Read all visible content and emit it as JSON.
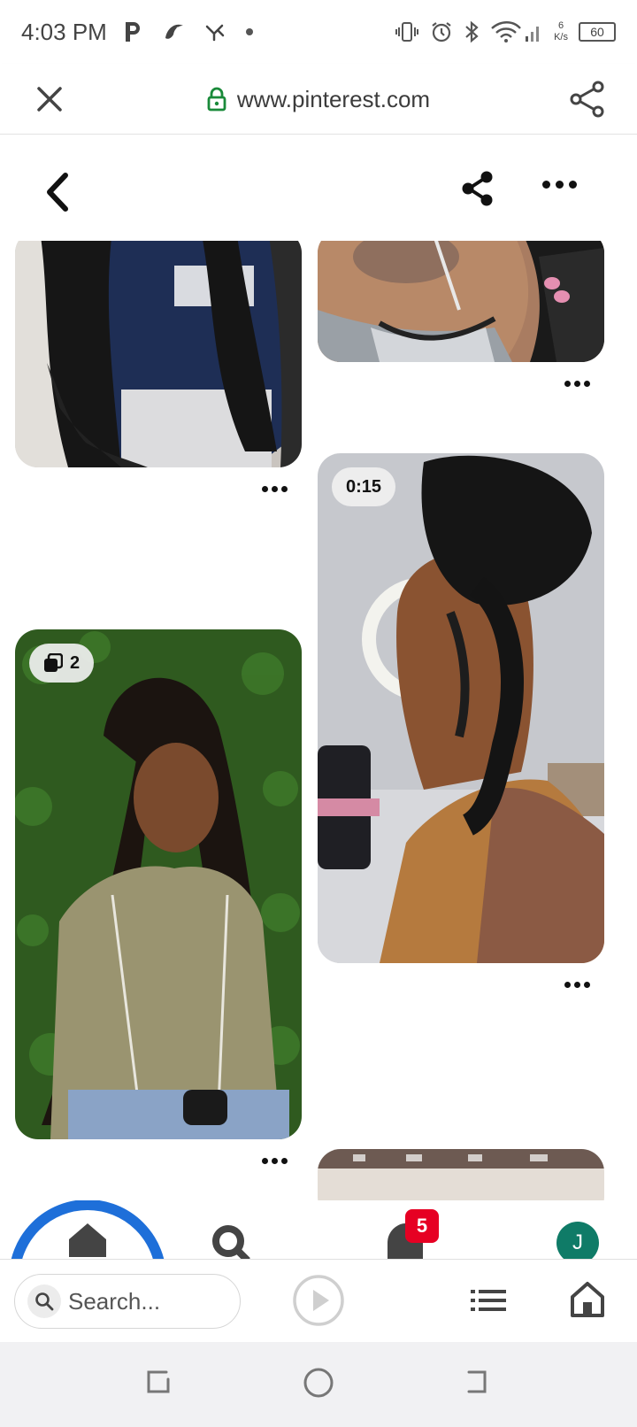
{
  "status_bar": {
    "time": "4:03 PM",
    "net_speed_value": "6",
    "net_speed_unit": "K/s",
    "battery": "60"
  },
  "browser": {
    "url": "www.pinterest.com"
  },
  "pins": [
    {
      "badge": ""
    },
    {
      "badge": ""
    },
    {
      "badge": "0:15"
    },
    {
      "badge": "2"
    },
    {
      "badge": ""
    }
  ],
  "app_nav": {
    "notification_count": "5",
    "avatar_initial": "J"
  },
  "browser_toolbar": {
    "search_placeholder": "Search..."
  },
  "colors": {
    "brand_red": "#e60023",
    "home_ring": "#1e6fd9",
    "avatar": "#0f7b67",
    "lock_green": "#1a8a3a"
  }
}
